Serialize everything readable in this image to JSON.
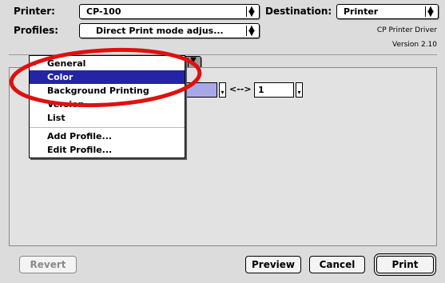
{
  "header": {
    "printer_label": "Printer:",
    "printer_value": "CP-100",
    "destination_label": "Destination:",
    "destination_value": "Printer",
    "profiles_label": "Profiles:",
    "profiles_value": "Direct Print mode adjus...",
    "driver_name": "CP Printer Driver",
    "driver_version": "Version 2.10"
  },
  "range": {
    "from_value": "",
    "separator": "<-->",
    "to_value": "1"
  },
  "menu": {
    "items": [
      {
        "label": "General",
        "checked": true
      },
      {
        "label": "Color",
        "selected": true
      },
      {
        "label": "Background Printing"
      },
      {
        "label": "Version"
      },
      {
        "label": "List"
      },
      {
        "label": "Add Profile..."
      },
      {
        "label": "Edit Profile..."
      }
    ],
    "checkmark": "✓"
  },
  "buttons": {
    "revert": "Revert",
    "preview": "Preview",
    "cancel": "Cancel",
    "print": "Print"
  },
  "colors": {
    "selection": "#2424a6",
    "annotation": "#e01010"
  }
}
